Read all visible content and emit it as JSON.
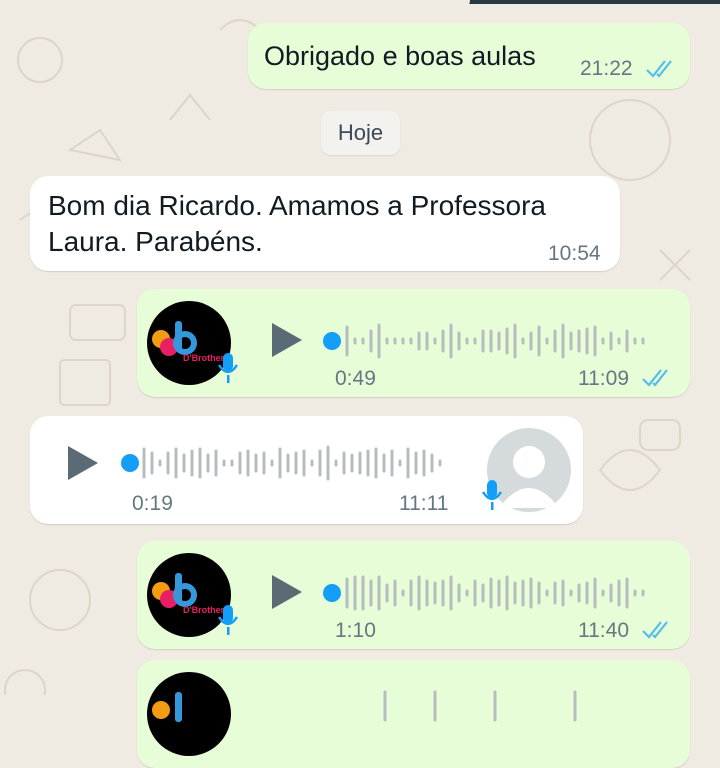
{
  "messages": {
    "m1": {
      "text": "Obrigado e boas aulas",
      "time": "21:22"
    },
    "day_label": "Hoje",
    "m2": {
      "text_line1": "Bom dia Ricardo. Amamos a Professora",
      "text_line2": "Laura. Parabéns.",
      "time": "10:54"
    },
    "v1": {
      "duration": "0:49",
      "time": "11:09"
    },
    "v2": {
      "duration": "0:19",
      "time": "11:11"
    },
    "v3": {
      "duration": "1:10",
      "time": "11:40"
    }
  },
  "colors": {
    "outgoing_bubble": "#e7fdd7",
    "incoming_bubble": "#ffffff",
    "read_ticks": "#53bdeb",
    "voice_dot": "#139ef7",
    "wallpaper": "#efeae2"
  },
  "icons": {
    "play": "play-icon",
    "mic": "microphone-icon",
    "ticks": "double-check-icon",
    "avatar_logo": "brand-logo-avatar",
    "avatar_default": "default-user-avatar"
  }
}
